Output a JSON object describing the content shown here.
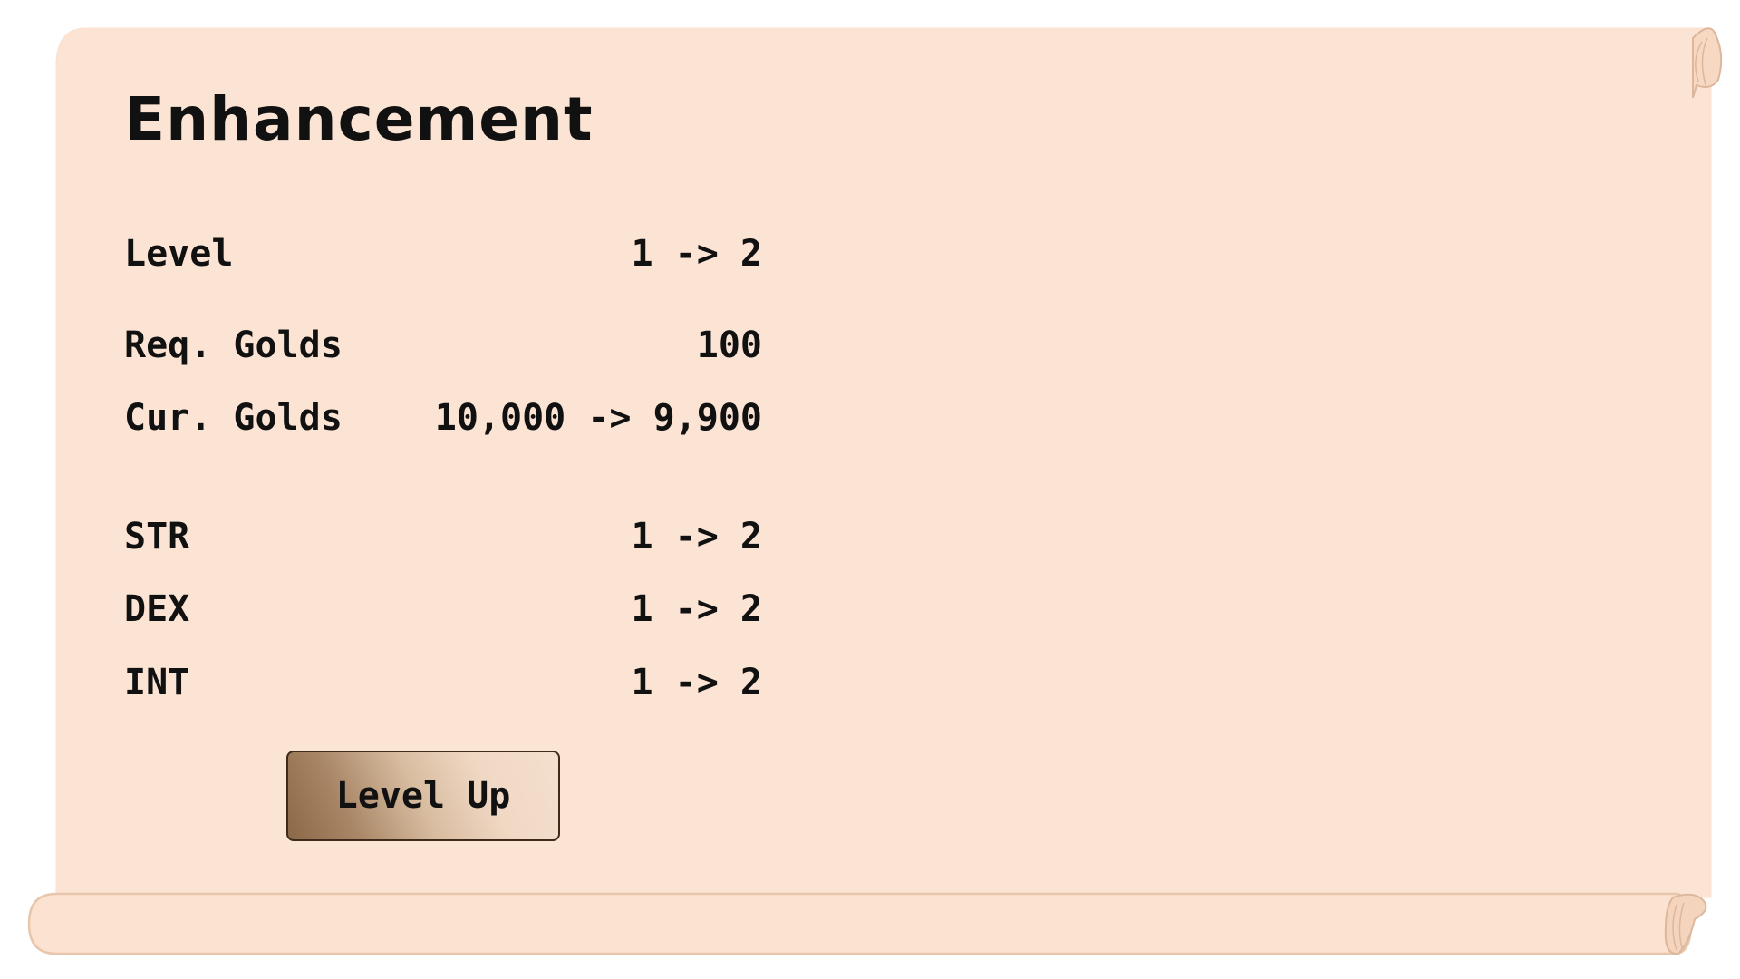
{
  "panel": {
    "title": "Enhancement"
  },
  "rows": {
    "level": {
      "label": "Level",
      "value": "1 -> 2"
    },
    "req_golds": {
      "label": "Req. Golds",
      "value": "100"
    },
    "cur_golds": {
      "label": "Cur. Golds",
      "value": "10,000 -> 9,900"
    },
    "str": {
      "label": "STR",
      "value": "1 -> 2"
    },
    "dex": {
      "label": "DEX",
      "value": "1 -> 2"
    },
    "int": {
      "label": "INT",
      "value": "1 -> 2"
    }
  },
  "actions": {
    "level_up_label": "Level Up"
  },
  "colors": {
    "parchment": "#fce4d4",
    "parchment_edge": "#e8c6ac",
    "text": "#111111",
    "button_dark": "#8a6848",
    "button_light": "#f4dfcd",
    "button_border": "#3e2a1a"
  }
}
